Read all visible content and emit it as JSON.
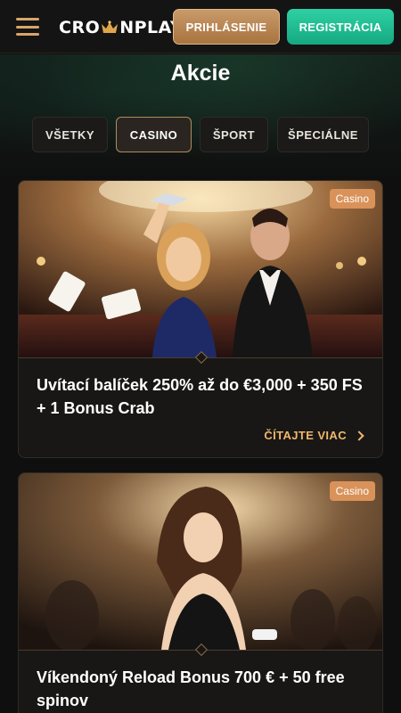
{
  "header": {
    "logo_left": "CRO",
    "logo_right": "NPLAY",
    "login_label": "PRIHLÁSENIE",
    "register_label": "REGISTRÁCIA"
  },
  "page": {
    "title": "Akcie"
  },
  "tabs": [
    {
      "label": "VŠETKY",
      "active": false
    },
    {
      "label": "CASINO",
      "active": true
    },
    {
      "label": "ŠPORT",
      "active": false
    },
    {
      "label": "ŠPECIÁLNE",
      "active": false
    }
  ],
  "promos": [
    {
      "badge": "Casino",
      "title": "Uvítací balíček 250% až do €3,000 + 350 FS + 1 Bonus Crab",
      "read_more": "ČÍTAJTE VIAC"
    },
    {
      "badge": "Casino",
      "title": "Víkendoný Reload Bonus 700 € + 50 free spinov"
    }
  ],
  "colors": {
    "accent_gold": "#d9a46a",
    "register_green": "#1fbf93",
    "badge": "#d9925a",
    "read_more": "#f1b76c"
  },
  "icons": [
    "menu-icon",
    "crown-icon",
    "chevron-right-icon"
  ]
}
